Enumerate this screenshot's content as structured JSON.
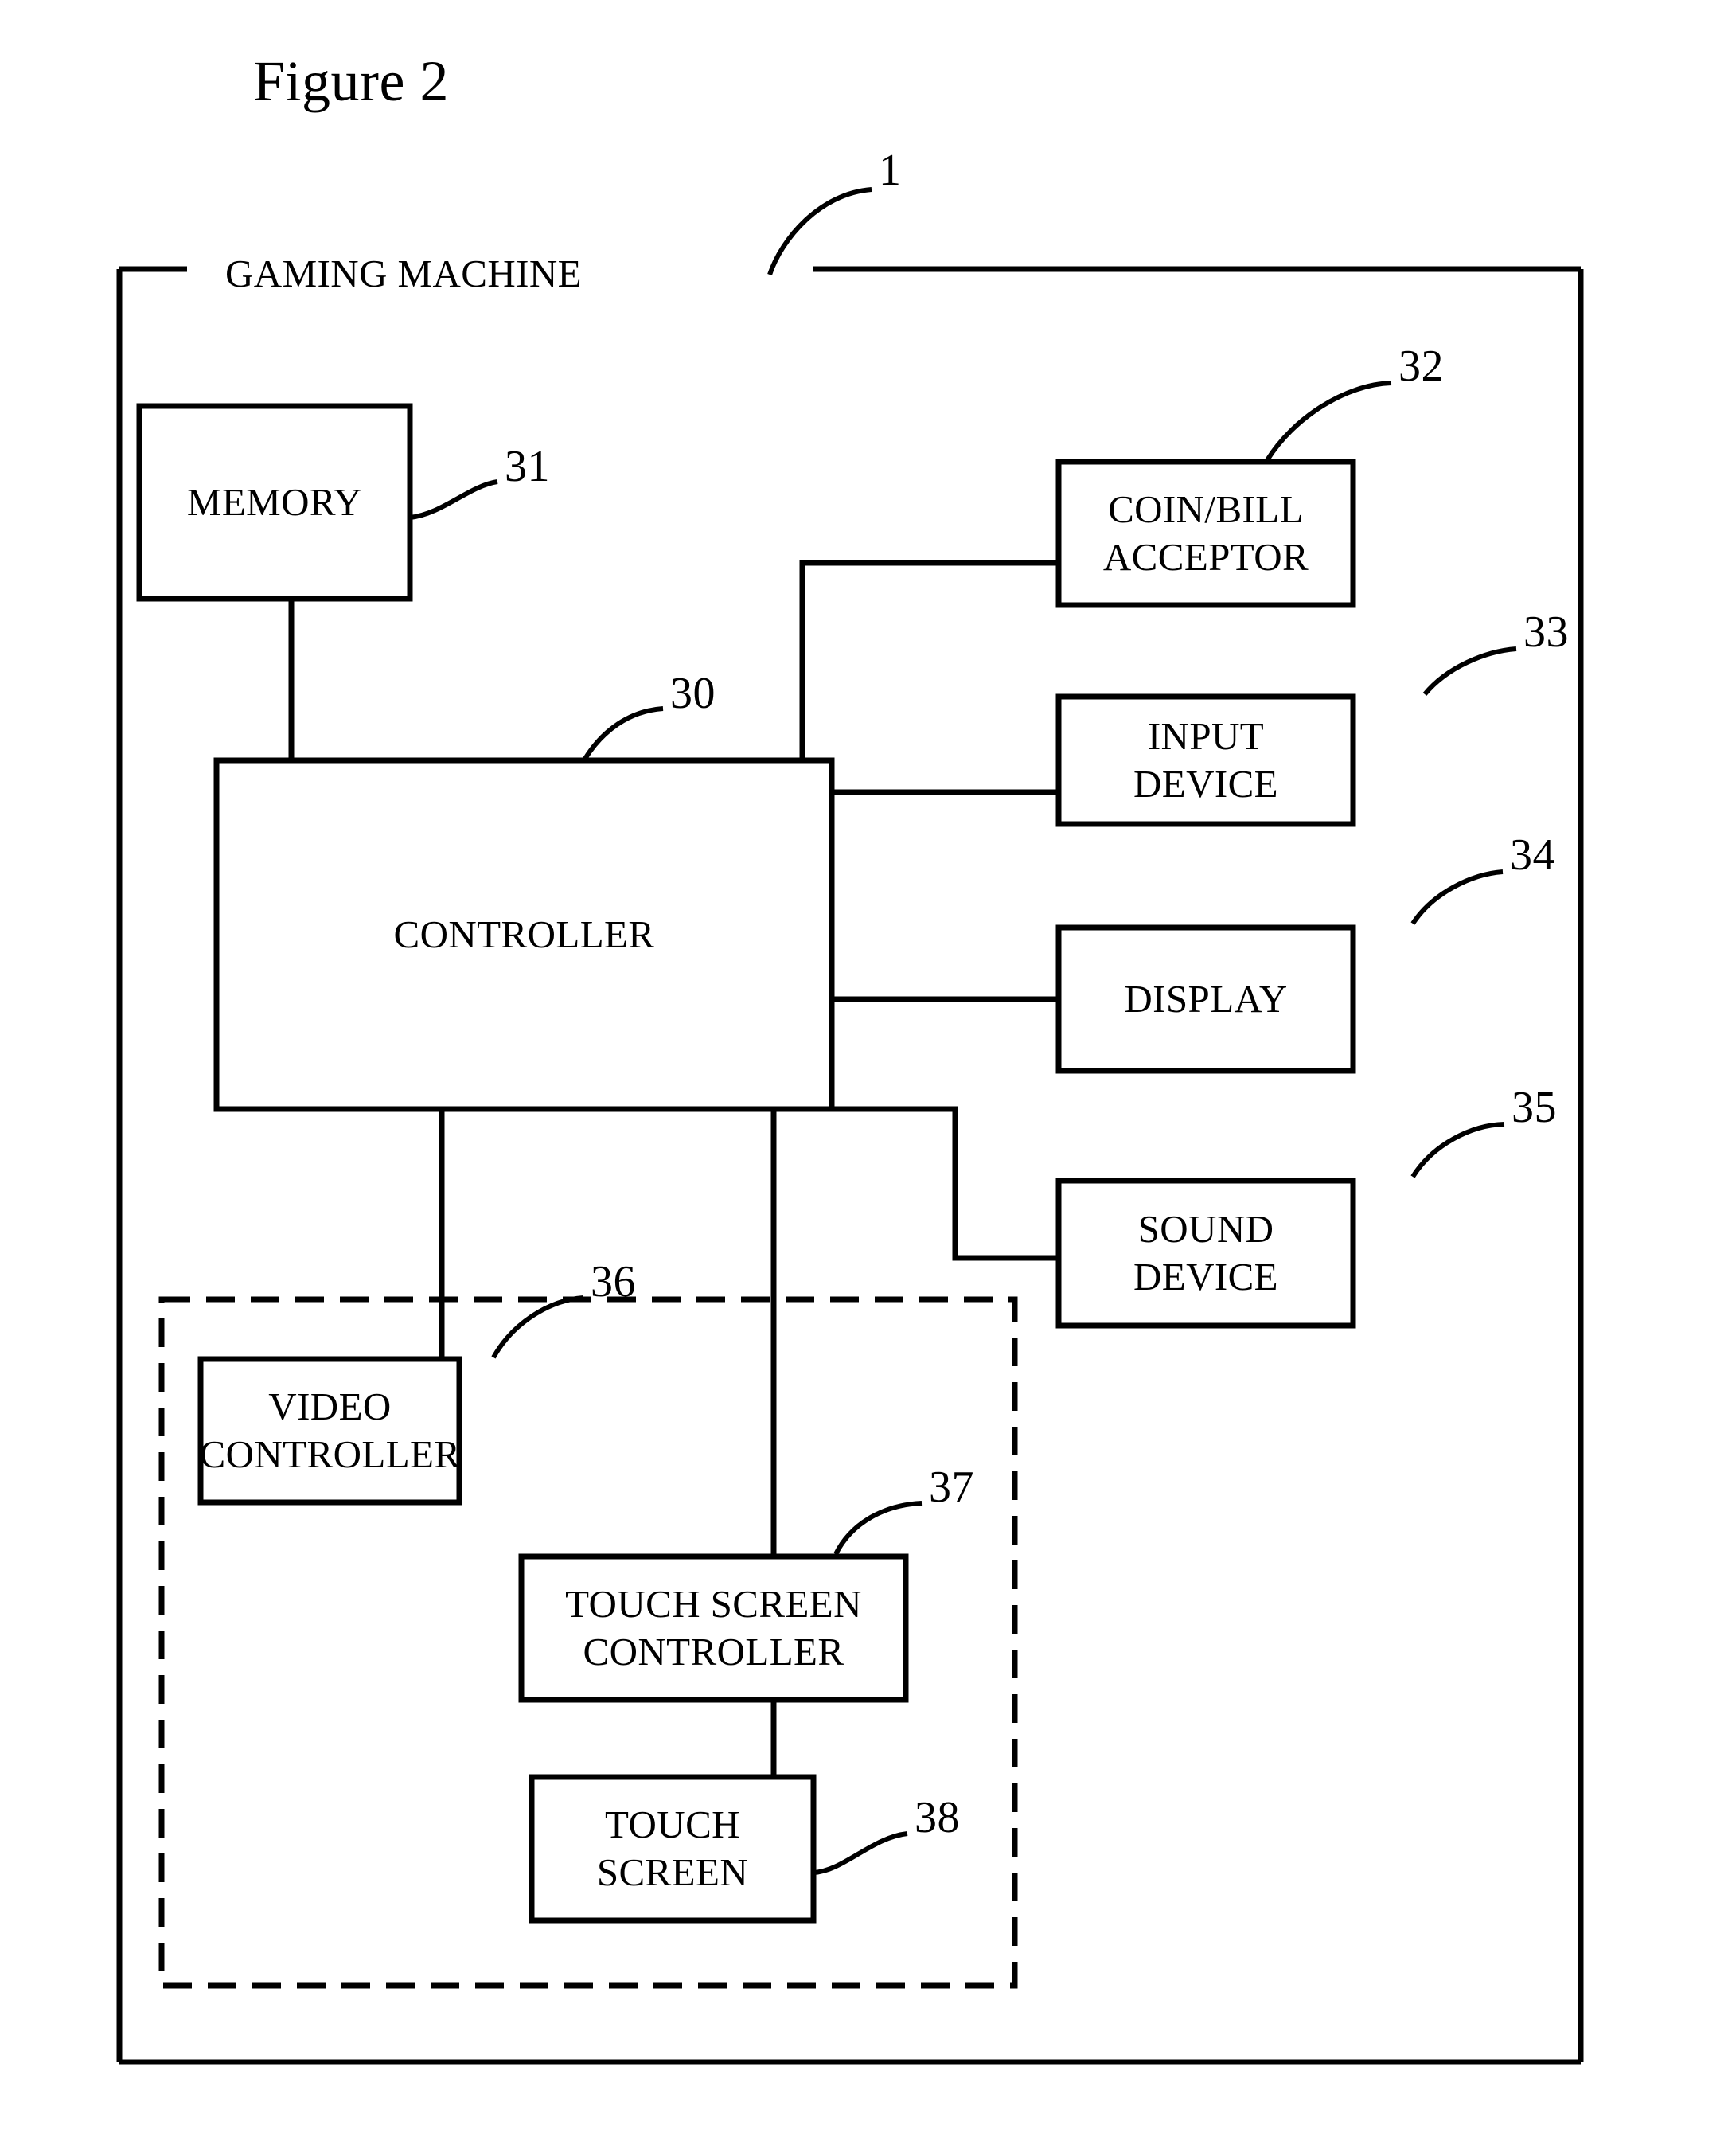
{
  "figure": {
    "title": "Figure 2",
    "enclosure_label": "GAMING MACHINE",
    "enclosure_ref": "1"
  },
  "blocks": [
    {
      "id": "memory",
      "label": "MEMORY",
      "ref": "31"
    },
    {
      "id": "controller",
      "label": "CONTROLLER",
      "ref": "30"
    },
    {
      "id": "coin_bill",
      "label": "COIN/BILL\nACCEPTOR",
      "ref": "32"
    },
    {
      "id": "input_device",
      "label": "INPUT\nDEVICE",
      "ref": "33"
    },
    {
      "id": "display",
      "label": "DISPLAY",
      "ref": "34"
    },
    {
      "id": "sound_device",
      "label": "SOUND\nDEVICE",
      "ref": "35"
    },
    {
      "id": "video_ctrl",
      "label": "VIDEO\nCONTROLLER",
      "ref": "36"
    },
    {
      "id": "ts_ctrl",
      "label": "TOUCH SCREEN\nCONTROLLER",
      "ref": "37"
    },
    {
      "id": "touch_screen",
      "label": "TOUCH SCREEN",
      "ref": "38"
    }
  ],
  "style": {
    "ink": "#000000",
    "paper": "#ffffff"
  }
}
